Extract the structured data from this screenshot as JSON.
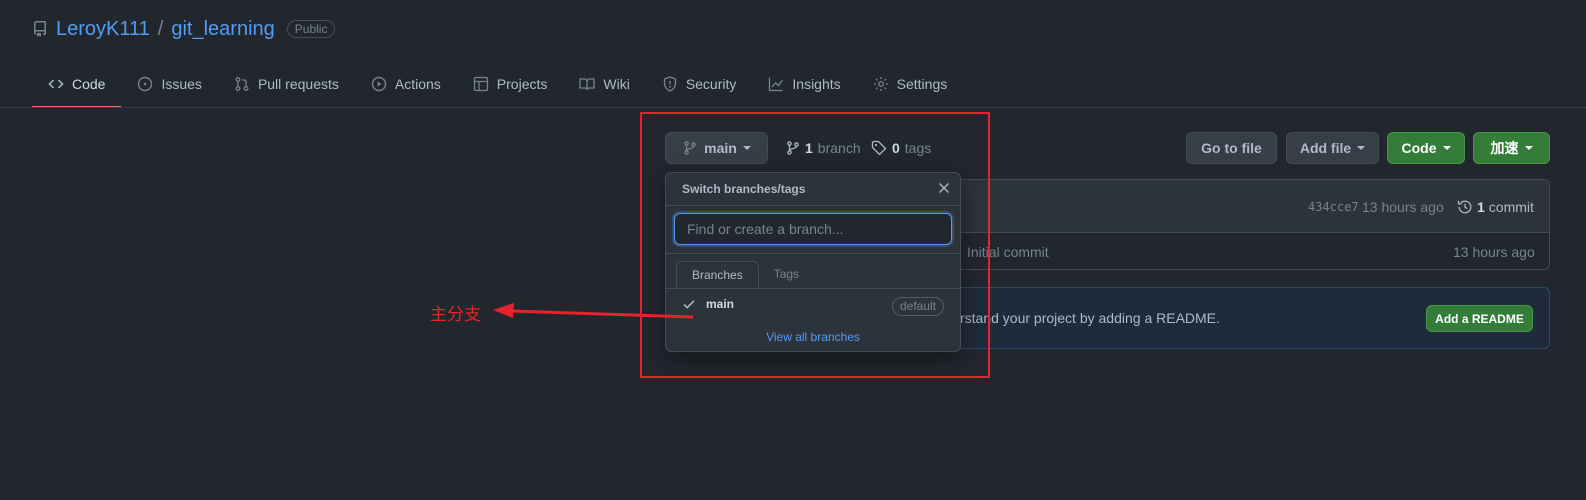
{
  "repo": {
    "owner": "LeroyK111",
    "separator": "/",
    "name": "git_learning",
    "visibility": "Public"
  },
  "tabs": [
    {
      "label": "Code",
      "icon": "code-icon",
      "active": true
    },
    {
      "label": "Issues",
      "icon": "issue-icon"
    },
    {
      "label": "Pull requests",
      "icon": "pull-request-icon"
    },
    {
      "label": "Actions",
      "icon": "play-icon"
    },
    {
      "label": "Projects",
      "icon": "table-icon"
    },
    {
      "label": "Wiki",
      "icon": "book-icon"
    },
    {
      "label": "Security",
      "icon": "shield-icon"
    },
    {
      "label": "Insights",
      "icon": "graph-icon"
    },
    {
      "label": "Settings",
      "icon": "gear-icon"
    }
  ],
  "branch_button": {
    "label": "main"
  },
  "branches": {
    "count": "1",
    "label": "branch"
  },
  "tags": {
    "count": "0",
    "label": "tags"
  },
  "actions": {
    "goto_file": "Go to file",
    "add_file": "Add file",
    "code": "Code",
    "accelerate": "加速"
  },
  "commit": {
    "hash": "434cce7",
    "time": "13 hours ago",
    "count": "1",
    "label": "commit"
  },
  "file_row": {
    "message": "Initial commit",
    "time": "13 hours ago"
  },
  "readme": {
    "text": "rstand your project by adding a README.",
    "button": "Add a README"
  },
  "dropdown": {
    "title": "Switch branches/tags",
    "placeholder": "Find or create a branch...",
    "tab_branches": "Branches",
    "tab_tags": "Tags",
    "item": "main",
    "item_badge": "default",
    "view_all": "View all branches"
  },
  "annotation": {
    "label": "主分支",
    "color": "#e8222a"
  },
  "colors": {
    "background": "#22272e",
    "link": "#539bf5",
    "green": "#347d39",
    "active_tab": "#ec775c"
  }
}
